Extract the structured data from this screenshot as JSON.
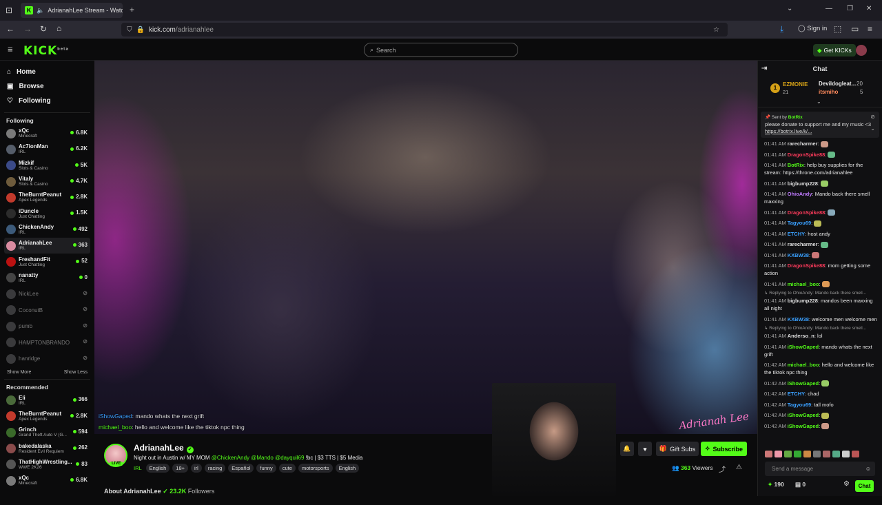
{
  "browser": {
    "tab_title": "AdrianahLee Stream - Watc",
    "url_host": "kick.com",
    "url_path": "/adrianahlee",
    "sign_in": "Sign in"
  },
  "topnav": {
    "logo": "KICK",
    "logo_sup": "beta",
    "search_placeholder": "Search",
    "get_kicks": "Get KICKs"
  },
  "sidebar": {
    "nav": [
      {
        "label": "Home",
        "icon": "home-icon"
      },
      {
        "label": "Browse",
        "icon": "browse-icon"
      },
      {
        "label": "Following",
        "icon": "heart-icon"
      }
    ],
    "following_title": "Following",
    "following": [
      {
        "name": "xQc",
        "category": "Minecraft",
        "viewers": "6.8K",
        "color": "#7a7a7a"
      },
      {
        "name": "Ac7ionMan",
        "category": "IRL",
        "viewers": "6.2K",
        "color": "#555d6a"
      },
      {
        "name": "Mizkif",
        "category": "Slots & Casino",
        "viewers": "5K",
        "color": "#3b4a88"
      },
      {
        "name": "Vitaly",
        "category": "Slots & Casino",
        "viewers": "4.7K",
        "color": "#6e5b3c"
      },
      {
        "name": "TheBurntPeanut",
        "category": "Apex Legends",
        "viewers": "2.8K",
        "color": "#c23a2c"
      },
      {
        "name": "iDuncle",
        "category": "Just Chatting",
        "viewers": "1.5K",
        "color": "#2c2c2c"
      },
      {
        "name": "ChickenAndy",
        "category": "IRL",
        "viewers": "492",
        "color": "#3c5a7a"
      },
      {
        "name": "AdrianahLee",
        "category": "IRL",
        "viewers": "363",
        "color": "#d98ba0"
      },
      {
        "name": "FreshandFit",
        "category": "Just Chatting",
        "viewers": "52",
        "color": "#b11"
      },
      {
        "name": "nanatty",
        "category": "IRL",
        "viewers": "0",
        "color": "#444"
      }
    ],
    "offline": [
      "NickLee",
      "CoconutB",
      "pumb",
      "HAMPTONBRANDO",
      "hanridge"
    ],
    "show_more": "Show More",
    "show_less": "Show Less",
    "recommended_title": "Recommended",
    "recommended": [
      {
        "name": "Eli",
        "category": "IRL",
        "viewers": "366",
        "color": "#4a6a3a"
      },
      {
        "name": "TheBurntPeanut",
        "category": "Apex Legends",
        "viewers": "2.8K",
        "color": "#c23a2c"
      },
      {
        "name": "Grinch",
        "category": "Grand Theft Auto V (G...",
        "viewers": "594",
        "color": "#3a6a2a"
      },
      {
        "name": "bakedalaska",
        "category": "Resident Evil Requiem",
        "viewers": "262",
        "color": "#8a4b4b"
      },
      {
        "name": "ThatHighWrestling...",
        "category": "WWE 2K26",
        "viewers": "83",
        "color": "#555"
      },
      {
        "name": "xQc",
        "category": "Minecraft",
        "viewers": "6.8K",
        "color": "#7a7a7a"
      }
    ]
  },
  "video": {
    "overlay_line1_user": "iShowGaped",
    "overlay_line1_text": ": mando whats the next grift",
    "overlay_line2_user": "michael_boo",
    "overlay_line2_text": ": hello and welcome like the tiktok npc thing",
    "watermark": "Adrianah Lee"
  },
  "stream": {
    "name": "AdrianahLee",
    "live": "LIVE",
    "title_start": "Night out in Austin w/ MY MOM ",
    "mentions": "@ChickenAndy @Mando @dayquil69",
    "title_end": " !bc | $3 TTS | $5 Media",
    "category": "IRL",
    "tags": [
      "English",
      "18+",
      "irl",
      "racing",
      "Español",
      "funny",
      "cute",
      "motorsports",
      "English"
    ],
    "gift_subs": "Gift Subs",
    "subscribe": "Subscribe",
    "viewers": "363",
    "viewers_label": "Viewers",
    "about": "About AdrianahLee",
    "followers": "23.2K",
    "followers_label": "Followers"
  },
  "chat": {
    "title": "Chat",
    "leaderboard": [
      {
        "rank": "1",
        "name": "EZMONIE",
        "count": "21"
      },
      {
        "name": "Devildogleat...",
        "count": "20"
      },
      {
        "name": "itsmiho",
        "count": "5"
      }
    ],
    "pinned_by": "Sent by",
    "pinned_user": "BotRix",
    "pinned_text": "please donate to support me and my music <3 ",
    "pinned_link": "https://botrix.live/k/...",
    "messages": [
      {
        "time": "01:41 AM",
        "user": "rarecharmer",
        "text": ":",
        "color": "#e0e0e0"
      },
      {
        "time": "01:41 AM",
        "user": "DragonSpike88",
        "text": ":",
        "color": "#ff3b5c"
      },
      {
        "time": "01:41 AM",
        "user": "BotRix",
        "text": ": help buy supplies for the stream: https://throne.com/adrianahlee",
        "color": "#53fc18"
      },
      {
        "time": "01:41 AM",
        "user": "bigbump228",
        "text": ":",
        "color": "#e0e0e0"
      },
      {
        "time": "01:41 AM",
        "user": "OhioAndy",
        "text": ": Mando back there smell maxxing",
        "color": "#c07bff"
      },
      {
        "time": "01:41 AM",
        "user": "DragonSpike88",
        "text": ":",
        "color": "#ff3b5c"
      },
      {
        "time": "01:41 AM",
        "user": "Tagyou69",
        "text": ":",
        "color": "#3aa0ff"
      },
      {
        "time": "01:41 AM",
        "user": "ETCHY",
        "text": ": host andy",
        "color": "#3aa0ff"
      },
      {
        "time": "01:41 AM",
        "user": "rarecharmer",
        "text": ":",
        "color": "#e0e0e0"
      },
      {
        "time": "01:41 AM",
        "user": "KXBW38",
        "text": ":",
        "color": "#3aa0ff"
      },
      {
        "time": "01:41 AM",
        "user": "DragonSpike88",
        "text": ": mom getting some action",
        "color": "#ff3b5c"
      },
      {
        "time": "01:41 AM",
        "user": "michael_boo",
        "text": ":",
        "color": "#53fc18"
      },
      {
        "reply": "Replying to OhioAndy: Mando back there smell...",
        "time": "01:41 AM",
        "user": "bigbump228",
        "text": ": mandos been maxxing all night",
        "color": "#e0e0e0"
      },
      {
        "time": "01:41 AM",
        "user": "KXBW38",
        "text": ": welcome men welcome men",
        "color": "#3aa0ff"
      },
      {
        "reply": "Replying to OhioAndy: Mando back there smell...",
        "time": "01:41 AM",
        "user": "Anderso_n",
        "text": ": lol",
        "color": "#e0e0e0"
      },
      {
        "time": "01:41 AM",
        "user": "iShowGaped",
        "text": ": mando whats the next grift",
        "color": "#53fc18"
      },
      {
        "time": "01:42 AM",
        "user": "michael_boo",
        "text": ": hello and welcome like the tiktok npc thing",
        "color": "#53fc18"
      },
      {
        "time": "01:42 AM",
        "user": "iShowGaped",
        "text": ":",
        "color": "#53fc18"
      },
      {
        "time": "01:42 AM",
        "user": "ETCHY",
        "text": ": chad",
        "color": "#3aa0ff"
      },
      {
        "time": "01:42 AM",
        "user": "Tagyou69",
        "text": ": tall mofo",
        "color": "#3aa0ff"
      },
      {
        "time": "01:42 AM",
        "user": "iShowGaped",
        "text": ":",
        "color": "#53fc18"
      },
      {
        "time": "01:42 AM",
        "user": "iShowGaped",
        "text": ":",
        "color": "#53fc18"
      }
    ],
    "input_placeholder": "Send a message",
    "points": "190",
    "kicks": "0",
    "chat_button": "Chat"
  },
  "colors": {
    "accent": "#53fc18",
    "background": "#0b0b0c"
  }
}
